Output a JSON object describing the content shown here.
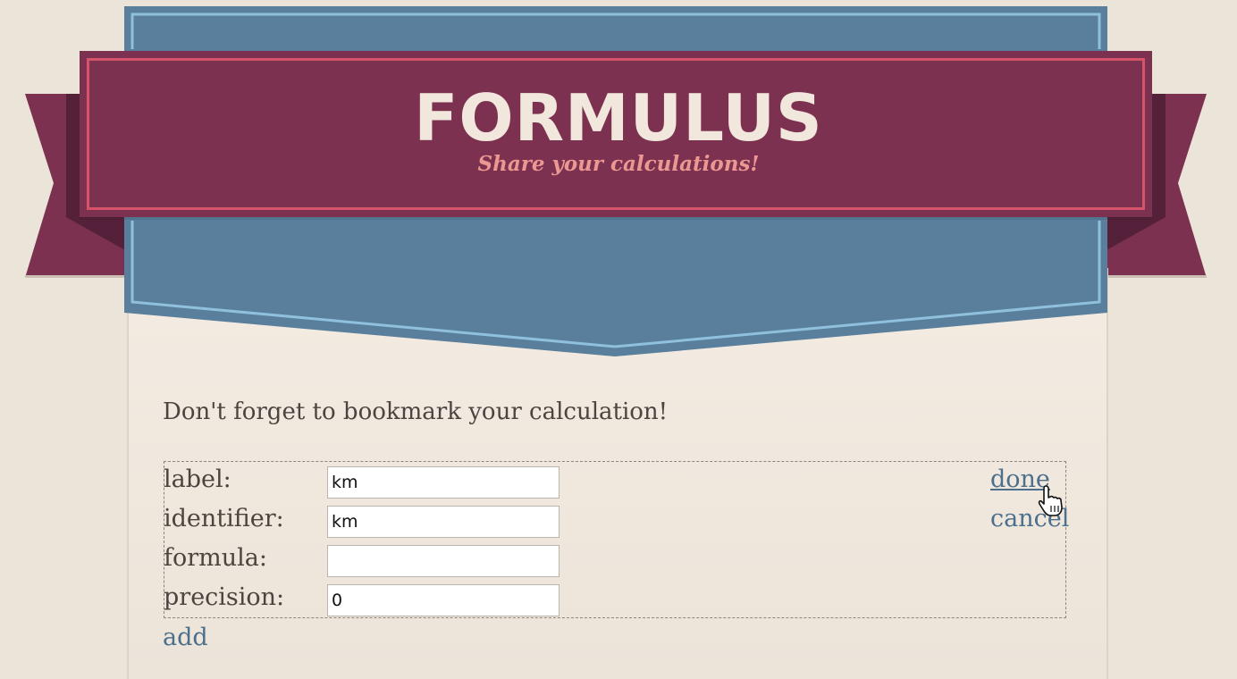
{
  "header": {
    "title": "FORMULUS",
    "subtitle": "Share your calculations!"
  },
  "colors": {
    "banner": "#7d3150",
    "banner_border": "#d5546a",
    "shield": "#5a7f9c",
    "shield_border": "#8fc0de",
    "title_text": "#f2e7dc",
    "subtitle_text": "#ea9891",
    "link": "#4b6f8d",
    "background": "#ebe4d9"
  },
  "main": {
    "reminder": "Don't forget to bookmark your calculation!",
    "form": {
      "fields": [
        {
          "label": "label:",
          "value": "km"
        },
        {
          "label": "identifier:",
          "value": "km"
        },
        {
          "label": "formula:",
          "value": ""
        },
        {
          "label": "precision:",
          "value": "0"
        }
      ],
      "done_label": "done",
      "cancel_label": "cancel"
    },
    "add_label": "add"
  }
}
